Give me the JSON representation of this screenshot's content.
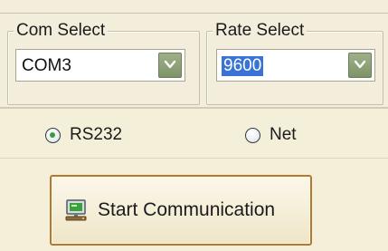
{
  "com_select": {
    "legend": "Com Select",
    "value": "COM3"
  },
  "rate_select": {
    "legend": "Rate Select",
    "value": "9600"
  },
  "mode": {
    "options": [
      {
        "label": "RS232",
        "checked": true
      },
      {
        "label": "Net",
        "checked": false
      }
    ]
  },
  "start_button": {
    "label": "Start Communication",
    "icon": "computer-icon"
  },
  "colors": {
    "background": "#f3eedb",
    "selection": "#3a73d6",
    "button_border": "#b07a35",
    "dropdown_button": "#8aa074",
    "radio_check": "#3c9b3a"
  }
}
